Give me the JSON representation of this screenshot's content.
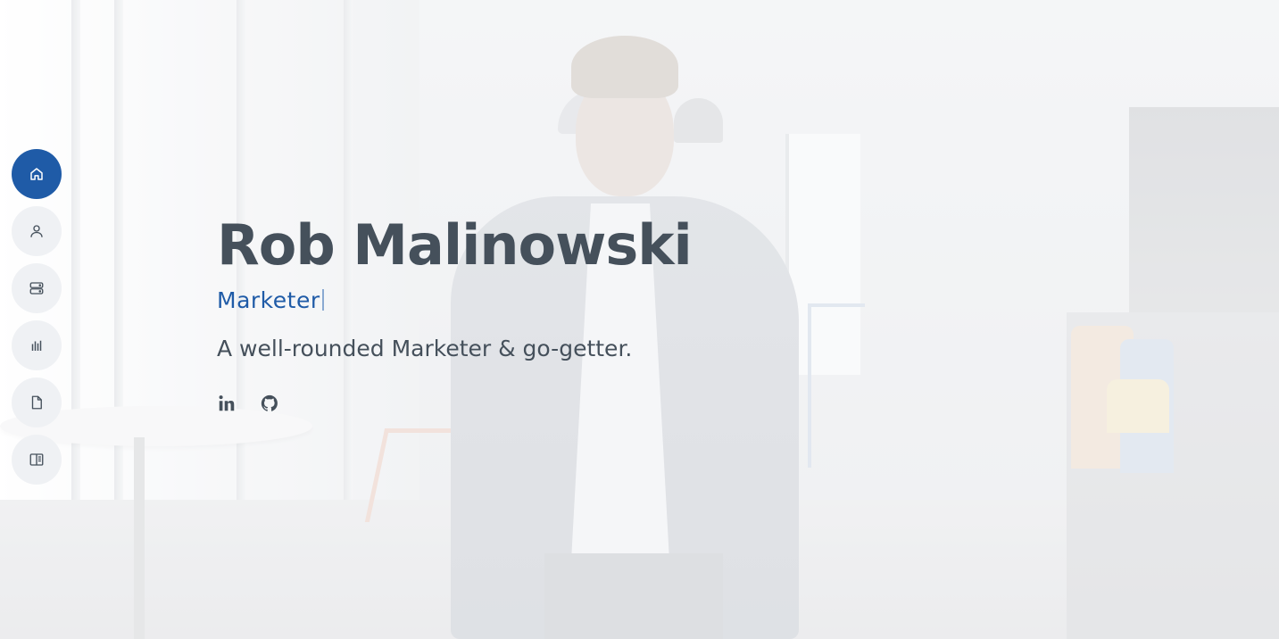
{
  "hero": {
    "name": "Rob Malinowski",
    "role": "Marketer",
    "tagline": "A well-rounded Marketer & go-getter.",
    "social": [
      {
        "icon": "linkedin-icon"
      },
      {
        "icon": "github-icon"
      }
    ]
  },
  "nav": {
    "items": [
      {
        "icon": "home-icon",
        "active": true
      },
      {
        "icon": "person-icon",
        "active": false
      },
      {
        "icon": "server-icon",
        "active": false
      },
      {
        "icon": "bar-chart-icon",
        "active": false
      },
      {
        "icon": "file-icon",
        "active": false
      },
      {
        "icon": "layout-icon",
        "active": false
      }
    ]
  },
  "colors": {
    "accent": "#1f5ba7",
    "heading": "#45505b",
    "nav_background": "#eef0f3",
    "nav_icon": "#45505b"
  }
}
